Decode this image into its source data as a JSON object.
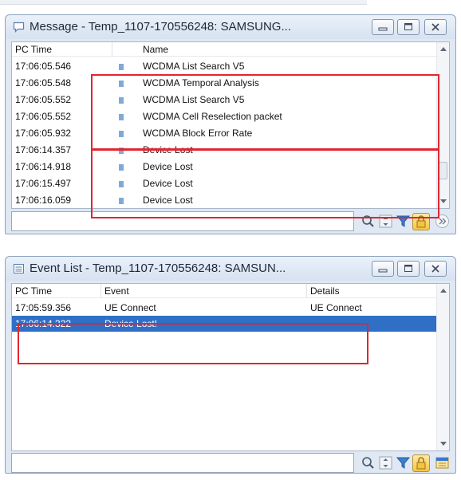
{
  "message_window": {
    "title": "Message - Temp_1107-170556248: SAMSUNG...",
    "columns": [
      "PC Time",
      "Name"
    ],
    "rows": [
      {
        "time": "17:06:05.546",
        "name": "WCDMA List Search V5"
      },
      {
        "time": "17:06:05.548",
        "name": "WCDMA Temporal Analysis"
      },
      {
        "time": "17:06:05.552",
        "name": "WCDMA List Search V5"
      },
      {
        "time": "17:06:05.552",
        "name": "WCDMA Cell Reselection packet"
      },
      {
        "time": "17:06:05.932",
        "name": "WCDMA Block Error Rate"
      },
      {
        "time": "17:06:14.357",
        "name": "Device Lost"
      },
      {
        "time": "17:06:14.918",
        "name": "Device Lost"
      },
      {
        "time": "17:06:15.497",
        "name": "Device Lost"
      },
      {
        "time": "17:06:16.059",
        "name": "Device Lost"
      }
    ],
    "search_value": ""
  },
  "event_window": {
    "title": "Event List - Temp_1107-170556248: SAMSUN...",
    "columns": [
      "PC Time",
      "Event",
      "Details"
    ],
    "rows": [
      {
        "time": "17:05:59.356",
        "event": "UE Connect",
        "details": "UE Connect"
      },
      {
        "time": "17:06:14.322",
        "event": "Device Lost!",
        "details": "",
        "selected": true
      }
    ],
    "search_value": ""
  },
  "colors": {
    "selection": "#2f6fc6",
    "highlight_box": "#e0262f",
    "window_frame": "#dfe8f3",
    "lock_accent": "#f5c548"
  },
  "icons": {
    "title_message": "message-bubble-icon",
    "title_event": "event-list-icon",
    "minimize": "minimize-icon",
    "maximize": "maximize-icon",
    "close": "close-icon",
    "search": "search-icon",
    "sync": "sync-arrows-icon",
    "filter": "filter-icon",
    "lock": "lock-icon",
    "more": "double-chevron-icon",
    "export": "export-icon"
  }
}
